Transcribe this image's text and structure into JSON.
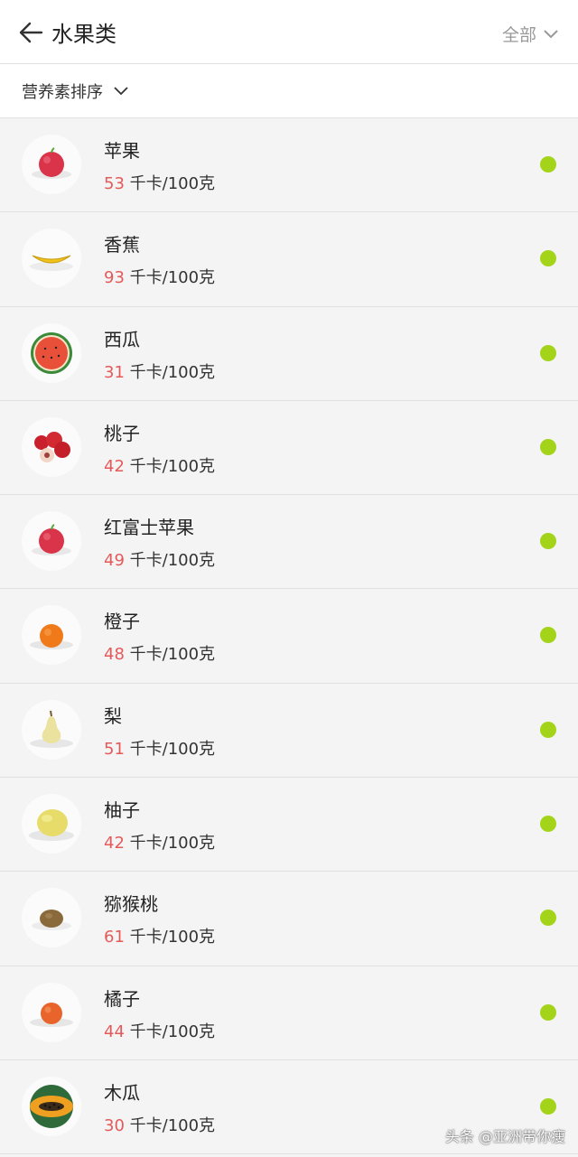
{
  "header": {
    "title": "水果类",
    "filter_label": "全部"
  },
  "sort": {
    "label": "营养素排序"
  },
  "unit_label": "千卡/100克",
  "items": [
    {
      "name": "苹果",
      "kcal": "53",
      "icon": "apple-icon"
    },
    {
      "name": "香蕉",
      "kcal": "93",
      "icon": "banana-icon"
    },
    {
      "name": "西瓜",
      "kcal": "31",
      "icon": "watermelon-icon"
    },
    {
      "name": "桃子",
      "kcal": "42",
      "icon": "peach-icon"
    },
    {
      "name": "红富士苹果",
      "kcal": "49",
      "icon": "apple-icon"
    },
    {
      "name": "橙子",
      "kcal": "48",
      "icon": "orange-icon"
    },
    {
      "name": "梨",
      "kcal": "51",
      "icon": "pear-icon"
    },
    {
      "name": "柚子",
      "kcal": "42",
      "icon": "pomelo-icon"
    },
    {
      "name": "猕猴桃",
      "kcal": "61",
      "icon": "kiwi-icon"
    },
    {
      "name": "橘子",
      "kcal": "44",
      "icon": "tangerine-icon"
    },
    {
      "name": "木瓜",
      "kcal": "30",
      "icon": "papaya-icon"
    }
  ],
  "status_color": "#a3d41a",
  "kcal_color": "#e45a5a",
  "watermark": "头条 @亚洲带你瘦"
}
